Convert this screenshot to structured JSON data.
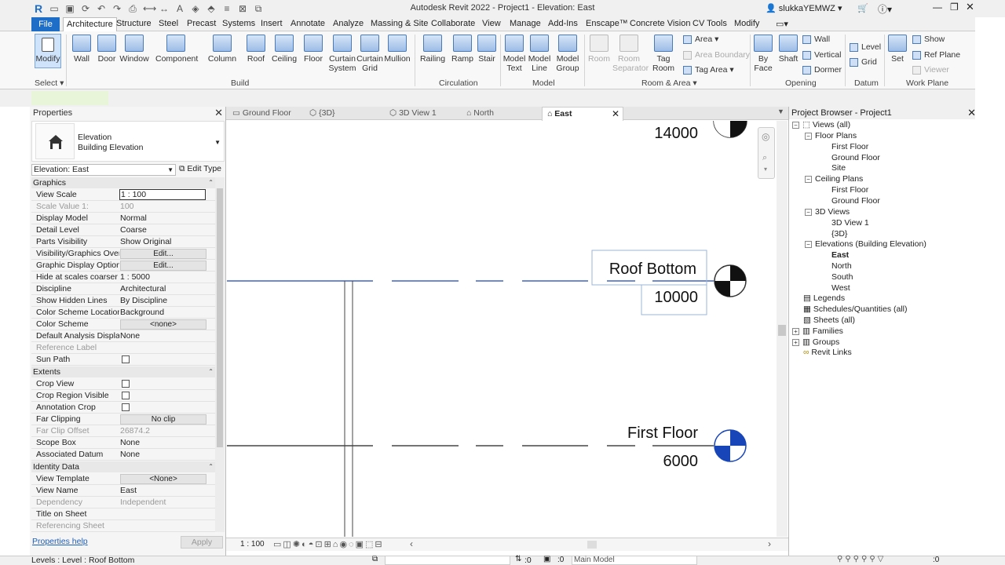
{
  "window": {
    "title": "Autodesk Revit 2022 - Project1 - Elevation: East",
    "user": "slukkaYEMWZ"
  },
  "ribbon_tabs": [
    "File",
    "Architecture",
    "Structure",
    "Steel",
    "Precast",
    "Systems",
    "Insert",
    "Annotate",
    "Analyze",
    "Massing & Site",
    "Collaborate",
    "View",
    "Manage",
    "Add-Ins",
    "Enscape™",
    "Concrete Vision",
    "CV Tools",
    "Modify"
  ],
  "ribbon": {
    "select": {
      "modify": "Modify",
      "panel": "Select"
    },
    "build": {
      "wall": "Wall",
      "door": "Door",
      "window": "Window",
      "component": "Component",
      "column": "Column",
      "roof": "Roof",
      "ceiling": "Ceiling",
      "floor": "Floor",
      "curtain_system_1": "Curtain",
      "curtain_system_2": "System",
      "curtain_grid_1": "Curtain",
      "curtain_grid_2": "Grid",
      "mullion": "Mullion",
      "panel": "Build"
    },
    "circulation": {
      "railing": "Railing",
      "ramp": "Ramp",
      "stair": "Stair",
      "panel": "Circulation"
    },
    "model": {
      "model_text_1": "Model",
      "model_text_2": "Text",
      "model_line_1": "Model",
      "model_line_2": "Line",
      "model_group_1": "Model",
      "model_group_2": "Group",
      "panel": "Model"
    },
    "room_area": {
      "room": "Room",
      "room_sep_1": "Room",
      "room_sep_2": "Separator",
      "tag_room_1": "Tag",
      "tag_room_2": "Room",
      "area": "Area",
      "area_boundary": "Area  Boundary",
      "tag_area": "Tag  Area",
      "panel": "Room & Area"
    },
    "opening": {
      "by_face_1": "By",
      "by_face_2": "Face",
      "shaft": "Shaft",
      "wall": "Wall",
      "vertical": "Vertical",
      "dormer": "Dormer",
      "panel": "Opening"
    },
    "datum": {
      "level": "Level",
      "grid": "Grid",
      "panel": "Datum"
    },
    "work_plane": {
      "set": "Set",
      "show": "Show",
      "ref_plane": "Ref  Plane",
      "viewer": "Viewer",
      "panel": "Work Plane"
    }
  },
  "properties": {
    "header": "Properties",
    "type_name": "Elevation",
    "type_sub": "Building Elevation",
    "selector": "Elevation: East",
    "edit_type": "Edit Type",
    "sections": {
      "graphics": "Graphics",
      "extents": "Extents",
      "identity": "Identity Data"
    },
    "graphics_rows": [
      {
        "k": "View Scale",
        "v": "1 : 100"
      },
      {
        "k": "Scale Value    1:",
        "v": "100"
      },
      {
        "k": "Display Model",
        "v": "Normal"
      },
      {
        "k": "Detail Level",
        "v": "Coarse"
      },
      {
        "k": "Parts Visibility",
        "v": "Show Original"
      },
      {
        "k": "Visibility/Graphics Over...",
        "v": "Edit..."
      },
      {
        "k": "Graphic Display Options",
        "v": "Edit..."
      },
      {
        "k": "Hide at scales coarser t...",
        "v": "1 : 5000"
      },
      {
        "k": "Discipline",
        "v": "Architectural"
      },
      {
        "k": "Show Hidden Lines",
        "v": "By Discipline"
      },
      {
        "k": "Color Scheme Location",
        "v": "Background"
      },
      {
        "k": "Color Scheme",
        "v": "<none>"
      },
      {
        "k": "Default Analysis Displa...",
        "v": "None"
      },
      {
        "k": "Reference Label",
        "v": ""
      },
      {
        "k": "Sun Path",
        "v": ""
      }
    ],
    "extents_rows": [
      {
        "k": "Crop View",
        "v": ""
      },
      {
        "k": "Crop Region Visible",
        "v": ""
      },
      {
        "k": "Annotation Crop",
        "v": ""
      },
      {
        "k": "Far Clipping",
        "v": "No clip"
      },
      {
        "k": "Far Clip Offset",
        "v": "26874.2"
      },
      {
        "k": "Scope Box",
        "v": "None"
      },
      {
        "k": "Associated Datum",
        "v": "None"
      }
    ],
    "identity_rows": [
      {
        "k": "View Template",
        "v": "<None>"
      },
      {
        "k": "View Name",
        "v": "East"
      },
      {
        "k": "Dependency",
        "v": "Independent"
      },
      {
        "k": "Title on Sheet",
        "v": ""
      },
      {
        "k": "Referencing Sheet",
        "v": ""
      }
    ],
    "help": "Properties help",
    "apply": "Apply"
  },
  "view_tabs": [
    "Ground Floor",
    "{3D}",
    "3D View 1",
    "North",
    "East"
  ],
  "canvas": {
    "levels": [
      {
        "name": "",
        "elevation": "14000"
      },
      {
        "name": "Roof Bottom",
        "elevation": "10000"
      },
      {
        "name": "First Floor",
        "elevation": "6000"
      }
    ]
  },
  "view_control": {
    "scale": "1 : 100"
  },
  "project_browser": {
    "header": "Project Browser - Project1",
    "views_all": "Views (all)",
    "floor_plans": "Floor Plans",
    "fp_items": [
      "First Floor",
      "Ground Floor",
      "Site"
    ],
    "ceiling_plans": "Ceiling Plans",
    "cp_items": [
      "First Floor",
      "Ground Floor"
    ],
    "views_3d": "3D Views",
    "v3d_items": [
      "3D View 1",
      "{3D}"
    ],
    "elevations": "Elevations (Building Elevation)",
    "elev_items": [
      "East",
      "North",
      "South",
      "West"
    ],
    "legends": "Legends",
    "schedules": "Schedules/Quantities (all)",
    "sheets": "Sheets (all)",
    "families": "Families",
    "groups": "Groups",
    "revit_links": "Revit Links"
  },
  "status": {
    "text": "Levels : Level : Roof Bottom",
    "count": ":0",
    "model": "Main Model",
    "filter": ":0"
  },
  "colors": {
    "accent": "#1e6ec8",
    "level_blue": "#1846b8"
  }
}
